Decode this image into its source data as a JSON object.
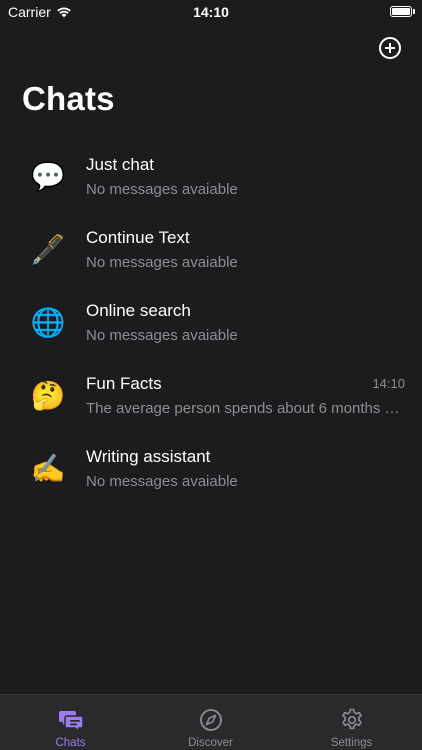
{
  "status_bar": {
    "carrier": "Carrier",
    "time": "14:10"
  },
  "header": {
    "title": "Chats",
    "add_icon": "plus-circle-icon"
  },
  "chats": [
    {
      "icon": "💬",
      "icon_name": "speech-bubble-icon",
      "name": "Just chat",
      "preview": "No messages avaiable",
      "time": ""
    },
    {
      "icon": "🖋️",
      "icon_name": "fountain-pen-icon",
      "name": "Continue Text",
      "preview": "No messages avaiable",
      "time": ""
    },
    {
      "icon": "🌐",
      "icon_name": "globe-icon",
      "name": "Online search",
      "preview": "No messages avaiable",
      "time": ""
    },
    {
      "icon": "🤔",
      "icon_name": "thinking-face-icon",
      "name": "Fun Facts",
      "preview": "The average person spends about 6 months of their life waiting for red lights to turn green.",
      "time": "14:10"
    },
    {
      "icon": "✍️",
      "icon_name": "writing-hand-icon",
      "name": "Writing assistant",
      "preview": "No messages avaiable",
      "time": ""
    }
  ],
  "tab_bar": {
    "tabs": [
      {
        "label": "Chats",
        "icon": "chat-bubbles-icon",
        "active": true
      },
      {
        "label": "Discover",
        "icon": "compass-icon",
        "active": false
      },
      {
        "label": "Settings",
        "icon": "gear-icon",
        "active": false
      }
    ]
  },
  "colors": {
    "background": "#1c1c1e",
    "accent": "#9b7df0",
    "secondary_text": "#8e8e93"
  }
}
